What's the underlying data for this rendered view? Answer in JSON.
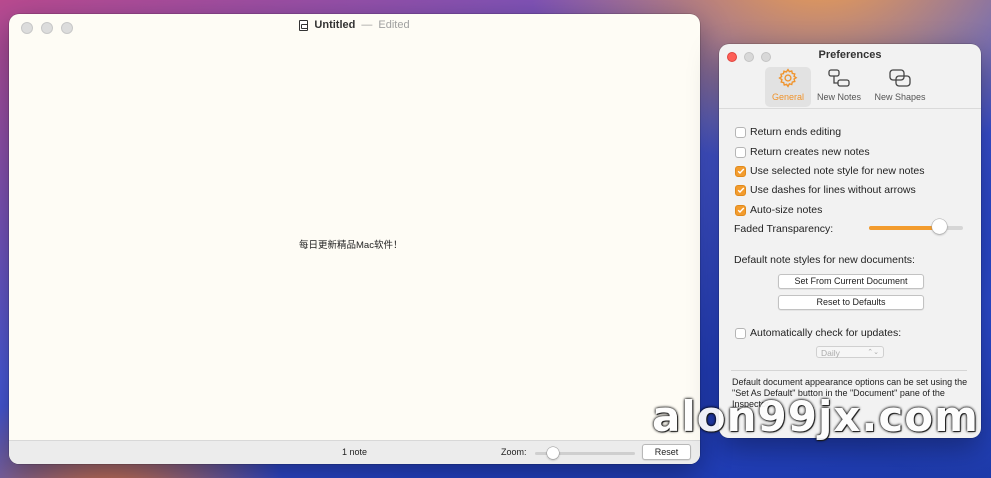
{
  "document_window": {
    "title": "Untitled",
    "separator": "—",
    "status": "Edited",
    "canvas_note_text": "每日更新精品Mac软件！",
    "statusbar": {
      "note_count": "1 note",
      "zoom_label": "Zoom:",
      "zoom_level": 0.18,
      "reset_label": "Reset"
    }
  },
  "preferences": {
    "title": "Preferences",
    "tabs": [
      {
        "label": "General",
        "icon": "gear-icon",
        "active": true
      },
      {
        "label": "New Notes",
        "icon": "connected-notes-icon",
        "active": false
      },
      {
        "label": "New Shapes",
        "icon": "overlapping-shapes-icon",
        "active": false
      }
    ],
    "options": [
      {
        "label": "Return ends editing",
        "checked": false
      },
      {
        "label": "Return creates new notes",
        "checked": false
      },
      {
        "label": "Use selected note style for new notes",
        "checked": true
      },
      {
        "label": "Use dashes for lines without arrows",
        "checked": true
      },
      {
        "label": "Auto-size notes",
        "checked": true
      }
    ],
    "faded_transparency_label": "Faded Transparency:",
    "faded_transparency_value": 0.76,
    "default_styles_label": "Default note styles for new documents:",
    "set_from_current_label": "Set From Current Document",
    "reset_to_defaults_label": "Reset to Defaults",
    "auto_check_label": "Automatically check for updates:",
    "auto_check_checked": false,
    "update_frequency": "Daily",
    "footer_text": "Default document appearance options can be set using the \"Set As Default\" button in the \"Document\" pane of the Inspector."
  },
  "colors": {
    "accent": "#f39c2e",
    "close_button": "#fe5f57"
  },
  "watermark": "alon99jx.com"
}
